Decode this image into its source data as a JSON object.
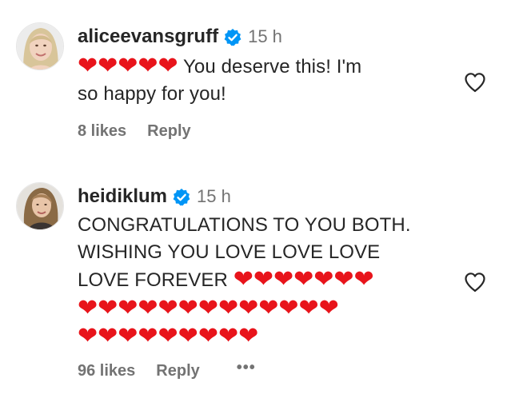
{
  "comments": [
    {
      "username": "aliceevansgruff",
      "time": "15 h",
      "hearts": "❤❤❤❤❤",
      "text_line1": " You deserve this! I'm",
      "text_line2": "so happy for you!",
      "likes": "8 likes",
      "reply": "Reply",
      "icons": {
        "avatar": "avatar-photo",
        "verified": "verified-badge-icon",
        "like": "heart-outline-icon"
      }
    },
    {
      "username": "heidiklum",
      "time": "15 h",
      "text_line1": "CONGRATULATIONS TO YOU BOTH.",
      "text_line2": "WISHING YOU LOVE LOVE LOVE",
      "text_line3": "LOVE FOREVER ",
      "hearts_line3": "❤❤❤❤❤❤❤",
      "hearts_line4": "❤❤❤❤❤❤❤❤❤❤❤❤❤",
      "hearts_line5": "❤❤❤❤❤❤❤❤❤",
      "likes": "96 likes",
      "reply": "Reply",
      "more": "•••",
      "icons": {
        "avatar": "avatar-photo",
        "verified": "verified-badge-icon",
        "like": "heart-outline-icon",
        "more": "more-options-icon"
      }
    }
  ],
  "colors": {
    "verified_blue": "#0095f6",
    "heart_red": "#e8141b",
    "secondary_text": "#737373",
    "primary_text": "#262626"
  }
}
